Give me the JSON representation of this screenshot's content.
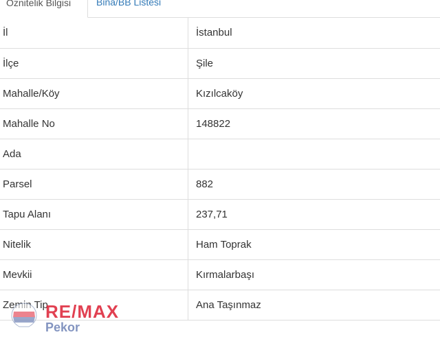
{
  "tabs": [
    {
      "label": "Öznitelik Bilgisi",
      "active": true
    },
    {
      "label": "Bina/BB Listesi",
      "active": false
    }
  ],
  "rows": [
    {
      "key": "İl",
      "value": "İstanbul"
    },
    {
      "key": "İlçe",
      "value": "Şile"
    },
    {
      "key": "Mahalle/Köy",
      "value": "Kızılcaköy"
    },
    {
      "key": "Mahalle No",
      "value": "148822"
    },
    {
      "key": "Ada",
      "value": ""
    },
    {
      "key": "Parsel",
      "value": "882"
    },
    {
      "key": "Tapu Alanı",
      "value": "237,71"
    },
    {
      "key": "Nitelik",
      "value": "Ham Toprak"
    },
    {
      "key": "Mevkii",
      "value": "Kırmalarbaşı"
    },
    {
      "key": "Zemin Tip",
      "value": "Ana Taşınmaz"
    }
  ],
  "watermark": {
    "brand": "RE/MAX",
    "subtitle": "Pekor",
    "icon": "remax-balloon-icon",
    "brand_color": "#dc1e32"
  }
}
